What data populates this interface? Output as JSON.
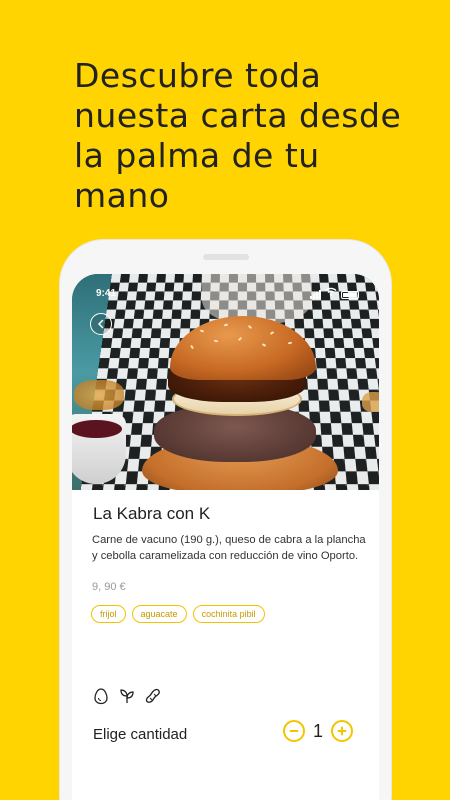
{
  "headline": "Descubre toda nuesta carta desde la palma de tu mano",
  "status_bar": {
    "time": "9:41"
  },
  "product": {
    "name": "La Kabra con K",
    "description": "Carne de vacuno (190 g.), queso de cabra a la plancha y cebolla caramelizada con reducción de vino Oporto.",
    "price": "9, 90 €",
    "tags": [
      "frijol",
      "aguacate",
      "cochinita pibil"
    ],
    "allergen_icons": [
      "egg-icon",
      "leaf-icon",
      "peanut-icon"
    ]
  },
  "quantity": {
    "label": "Elige cantidad",
    "value": "1"
  },
  "colors": {
    "brand_yellow": "#FFD400",
    "accent": "#F5C400",
    "text": "#222222"
  }
}
